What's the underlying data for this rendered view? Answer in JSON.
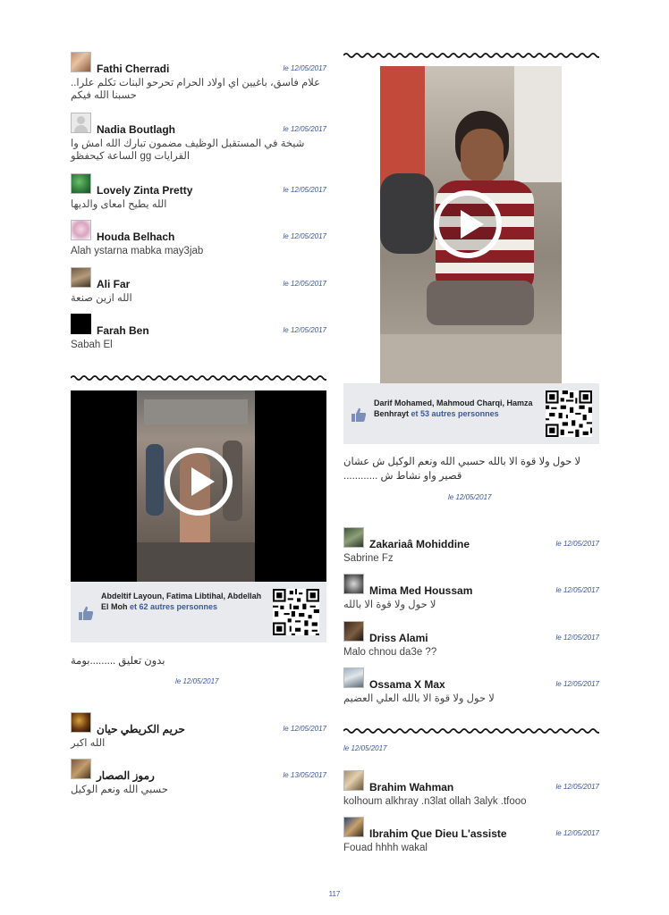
{
  "left_column": {
    "comments": [
      {
        "name": "Fathi Cherradi",
        "date": "le 12/05/2017",
        "text": "علام فاسق، باغيين اي اولاد الحرام تحرحو البنات تكلم علرا.. حسبنا الله فيكم"
      },
      {
        "name": "Nadia Boutlagh",
        "date": "le 12/05/2017",
        "text": "شيخة في المستقبل الوظيف مضمون تبارك الله امش وا القرايات gg الساعة كيحفظو"
      },
      {
        "name": "Lovely Zinta Pretty",
        "date": "le 12/05/2017",
        "text": "الله يطيح امعاى والديها"
      },
      {
        "name": "Houda Belhach",
        "date": "le 12/05/2017",
        "text": "Alah ystarna mabka may3jab"
      },
      {
        "name": "Ali Far",
        "date": "le 12/05/2017",
        "text": "الله ازين صنعة"
      },
      {
        "name": "Farah Ben",
        "date": "le 12/05/2017",
        "text": "Sabah El"
      }
    ],
    "video_post": {
      "likers": "Abdeltif Layoun, Fatima Libtihal, Abdellah El Moh",
      "likers_more": "et 62 autres personnes",
      "caption": "بدون تعليق .........بومة",
      "date": "le 12/05/2017"
    },
    "comments_after": [
      {
        "name": "حريم الكريطي حيان",
        "date": "le 12/05/2017",
        "text": "الله اكبر"
      },
      {
        "name": "رموز الصصار",
        "date": "le 13/05/2017",
        "text": "حسبي الله ونعم الوكيل"
      }
    ]
  },
  "right_column": {
    "video_post": {
      "likers": "Darif Mohamed, Mahmoud Charqi, Hamza Benhrayt",
      "likers_more": "et 53 autres personnes",
      "caption": "لا حول ولا قوة الا بالله حسبي الله ونعم الوكيل ش عشان قصير واو نشاط ش ............",
      "date": "le 12/05/2017"
    },
    "comments": [
      {
        "name": "Zakariaâ Mohiddine",
        "date": "le 12/05/2017",
        "text": "Sabrine Fz"
      },
      {
        "name": "Mima Med Houssam",
        "date": "le 12/05/2017",
        "text": "لا حول ولا قوة الا بالله"
      },
      {
        "name": "Driss Alami",
        "date": "le 12/05/2017",
        "text": "Malo chnou da3e ??"
      },
      {
        "name": "Ossama X Max",
        "date": "le 12/05/2017",
        "text": "لا حول ولا قوة الا بالله العلي العضيم"
      }
    ],
    "section_date": "le 12/05/2017",
    "comments_after": [
      {
        "name": "Brahim Wahman",
        "date": "le 12/05/2017",
        "text": "kolhoum alkhray .n3lat ollah 3alyk .tfooo"
      },
      {
        "name": "Ibrahim Que Dieu L'assiste",
        "date": "le 12/05/2017",
        "text": "Fouad hhhh wakal"
      }
    ]
  },
  "page_number": "117",
  "colors": {
    "link": "#3b5998",
    "likes_bg": "#e9eaee"
  },
  "icons": [
    "play-icon",
    "thumbs-up-icon",
    "qr-code-icon"
  ]
}
